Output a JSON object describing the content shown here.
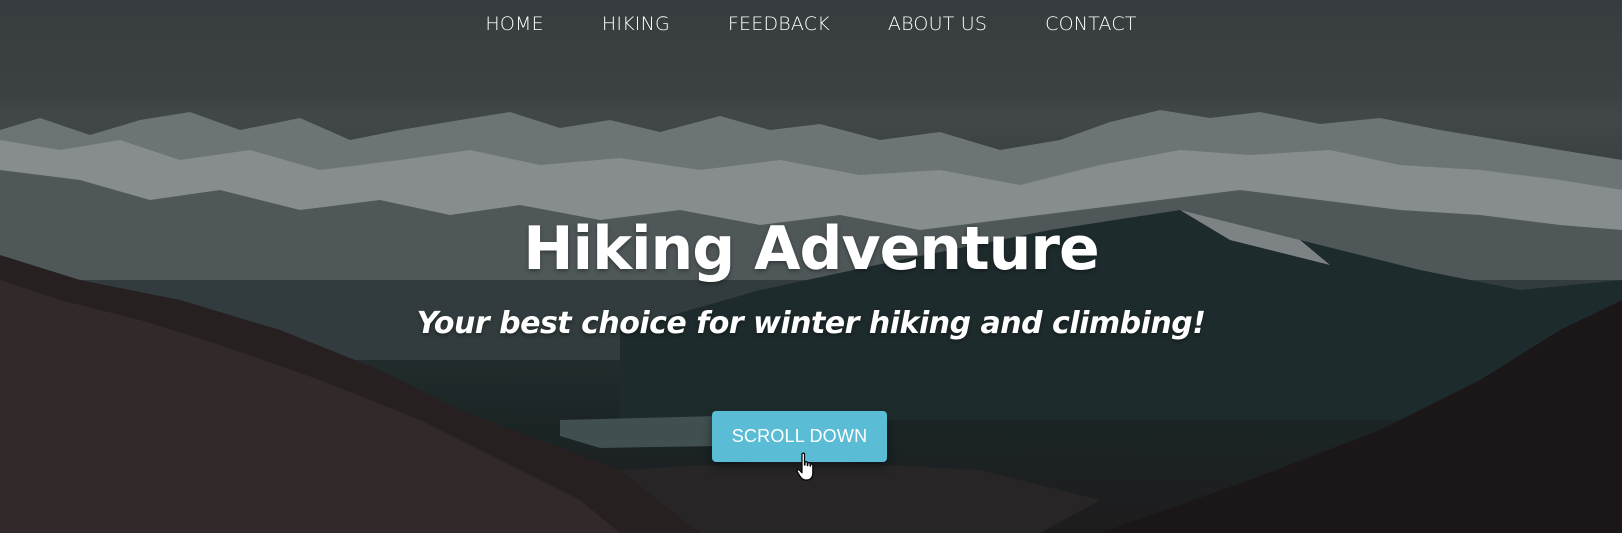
{
  "nav": {
    "items": [
      {
        "label": "HOME"
      },
      {
        "label": "HIKING"
      },
      {
        "label": "FEEDBACK"
      },
      {
        "label": "ABOUT US"
      },
      {
        "label": "CONTACT"
      }
    ]
  },
  "hero": {
    "title": "Hiking Adventure",
    "subtitle": "Your best choice for winter hiking and climbing!",
    "cta_label": "SCROLL DOWN"
  },
  "colors": {
    "accent": "#5bbcd6",
    "text": "#ffffff"
  },
  "icons": {
    "cursor": "hand-pointer-icon"
  }
}
